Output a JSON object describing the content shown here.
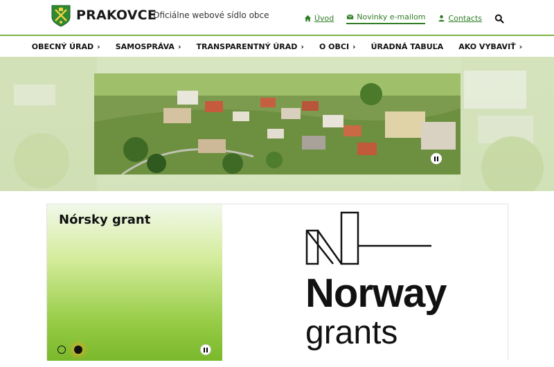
{
  "header": {
    "site_name": "PRAKOVCE",
    "site_subtitle": "Oficiálne webové sídlo obce",
    "links": [
      {
        "label": "Úvod",
        "icon": "home-icon"
      },
      {
        "label": "Novinky e-mailom",
        "icon": "envelope-icon"
      },
      {
        "label": "Contacts",
        "icon": "user-icon"
      }
    ]
  },
  "nav": {
    "items": [
      {
        "label": "OBECNÝ ÚRAD",
        "chevron": "›"
      },
      {
        "label": "SAMOSPRÁVA",
        "chevron": "›"
      },
      {
        "label": "TRANSPARENTNÝ ÚRAD",
        "chevron": "›"
      },
      {
        "label": "O OBCI",
        "chevron": "›"
      },
      {
        "label": "ÚRADNÁ TABUĽA",
        "chevron": ""
      },
      {
        "label": "AKO VYBAVIŤ",
        "chevron": "›"
      }
    ]
  },
  "grant": {
    "title": "Nórsky grant",
    "logo_word1": "Norway",
    "logo_word2": "grants"
  },
  "colors": {
    "accent": "#2e7d23",
    "line": "#7cb342"
  }
}
